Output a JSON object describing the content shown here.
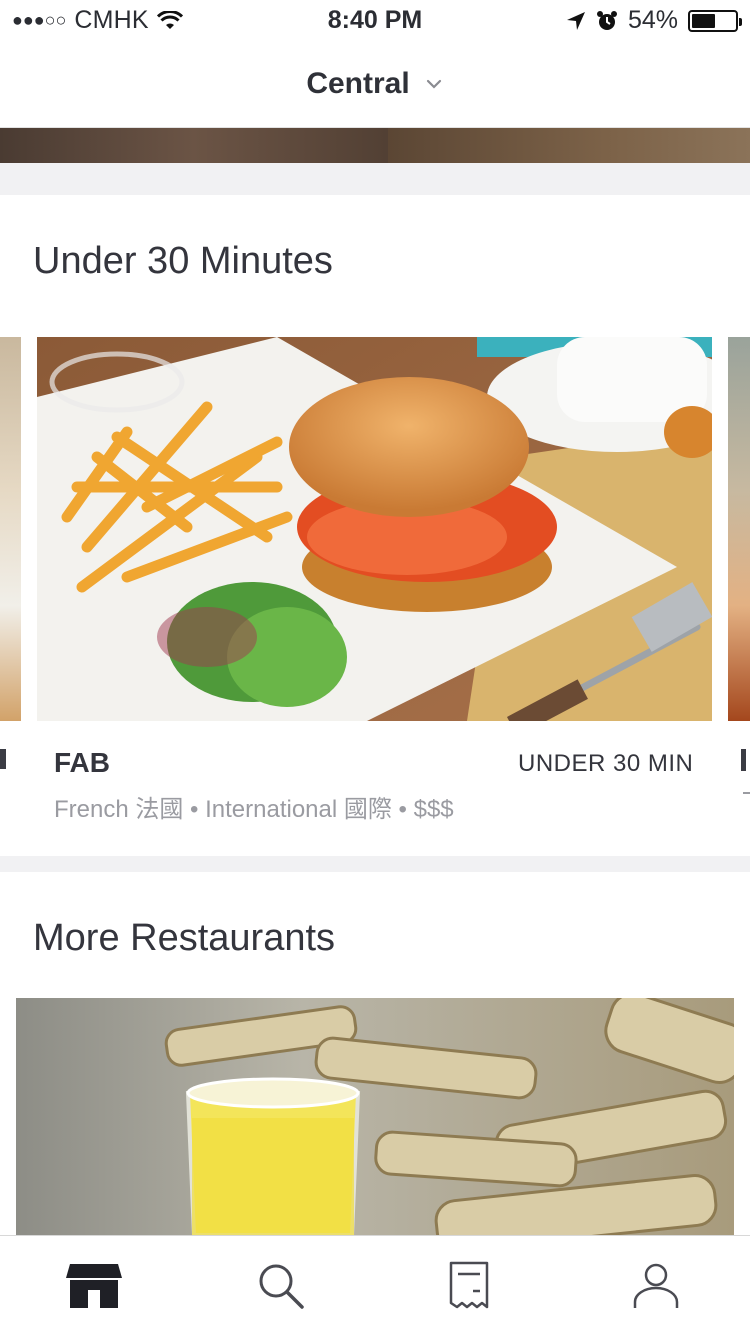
{
  "status_bar": {
    "signal": "●●●○○",
    "carrier": "CMHK",
    "time": "8:40 PM",
    "battery_percent": "54%",
    "battery_level": 0.54
  },
  "header": {
    "location": "Central"
  },
  "sections": {
    "under_30": {
      "title": "Under 30 Minutes",
      "card": {
        "name": "FAB",
        "eta": "UNDER 30 MIN",
        "meta": "French 法國 • International 國際 • $$$"
      }
    },
    "more": {
      "title": "More Restaurants"
    }
  },
  "tabs": [
    {
      "icon": "store-icon",
      "active": true
    },
    {
      "icon": "search-icon",
      "active": false
    },
    {
      "icon": "receipt-icon",
      "active": false
    },
    {
      "icon": "user-icon",
      "active": false
    }
  ],
  "colors": {
    "text_primary": "#34353d",
    "text_secondary": "#9a9ba1",
    "divider": "#f1f1f3",
    "tab_active": "#1f2026",
    "tab_inactive": "#4a4b52"
  }
}
